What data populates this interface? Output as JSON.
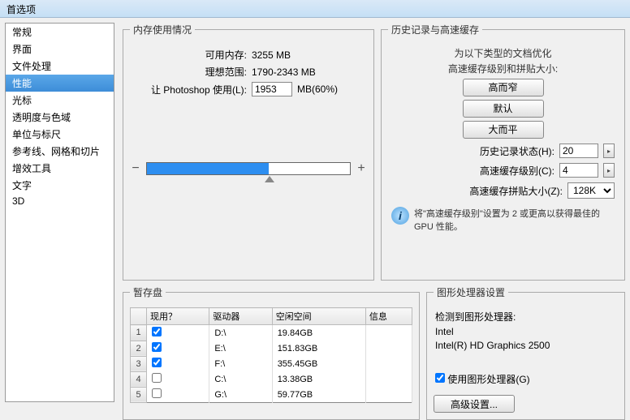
{
  "window": {
    "title": "首选项"
  },
  "sidebar": {
    "items": [
      "常规",
      "界面",
      "文件处理",
      "性能",
      "光标",
      "透明度与色域",
      "单位与标尺",
      "参考线、网格和切片",
      "增效工具",
      "文字",
      "3D"
    ],
    "selected_index": 3
  },
  "memory": {
    "legend": "内存使用情况",
    "available_label": "可用内存:",
    "available_value": "3255 MB",
    "ideal_label": "理想范围:",
    "ideal_value": "1790-2343 MB",
    "use_label": "让 Photoshop 使用(L):",
    "use_value": "1953",
    "use_suffix": "MB(60%)",
    "minus": "−",
    "plus": "+"
  },
  "history": {
    "legend": "历史记录与高速缓存",
    "line1": "为以下类型的文档优化",
    "line2": "高速缓存级别和拼贴大小:",
    "btn_tall": "高而窄",
    "btn_default": "默认",
    "btn_big": "大而平",
    "states_label": "历史记录状态(H):",
    "states_value": "20",
    "levels_label": "高速缓存级别(C):",
    "levels_value": "4",
    "tile_label": "高速缓存拼贴大小(Z):",
    "tile_value": "128K",
    "tip": "将\"高速缓存级别\"设置为 2 或更高以获得最佳的 GPU 性能。"
  },
  "scratch": {
    "legend": "暂存盘",
    "headers": {
      "active": "现用？",
      "drive": "驱动器",
      "free": "空闲空间",
      "info": "信息"
    },
    "rows": [
      {
        "n": "1",
        "checked": true,
        "drive": "D:\\",
        "free": "19.84GB"
      },
      {
        "n": "2",
        "checked": true,
        "drive": "E:\\",
        "free": "151.83GB"
      },
      {
        "n": "3",
        "checked": true,
        "drive": "F:\\",
        "free": "355.45GB"
      },
      {
        "n": "4",
        "checked": false,
        "drive": "C:\\",
        "free": "13.38GB"
      },
      {
        "n": "5",
        "checked": false,
        "drive": "G:\\",
        "free": "59.77GB"
      }
    ]
  },
  "gpu": {
    "legend": "图形处理器设置",
    "detected_label": "检测到图形处理器:",
    "vendor": "Intel",
    "model": "Intel(R) HD Graphics 2500",
    "use_gpu_label": "使用图形处理器(G)",
    "use_gpu_checked": true,
    "advanced_btn": "高级设置..."
  }
}
